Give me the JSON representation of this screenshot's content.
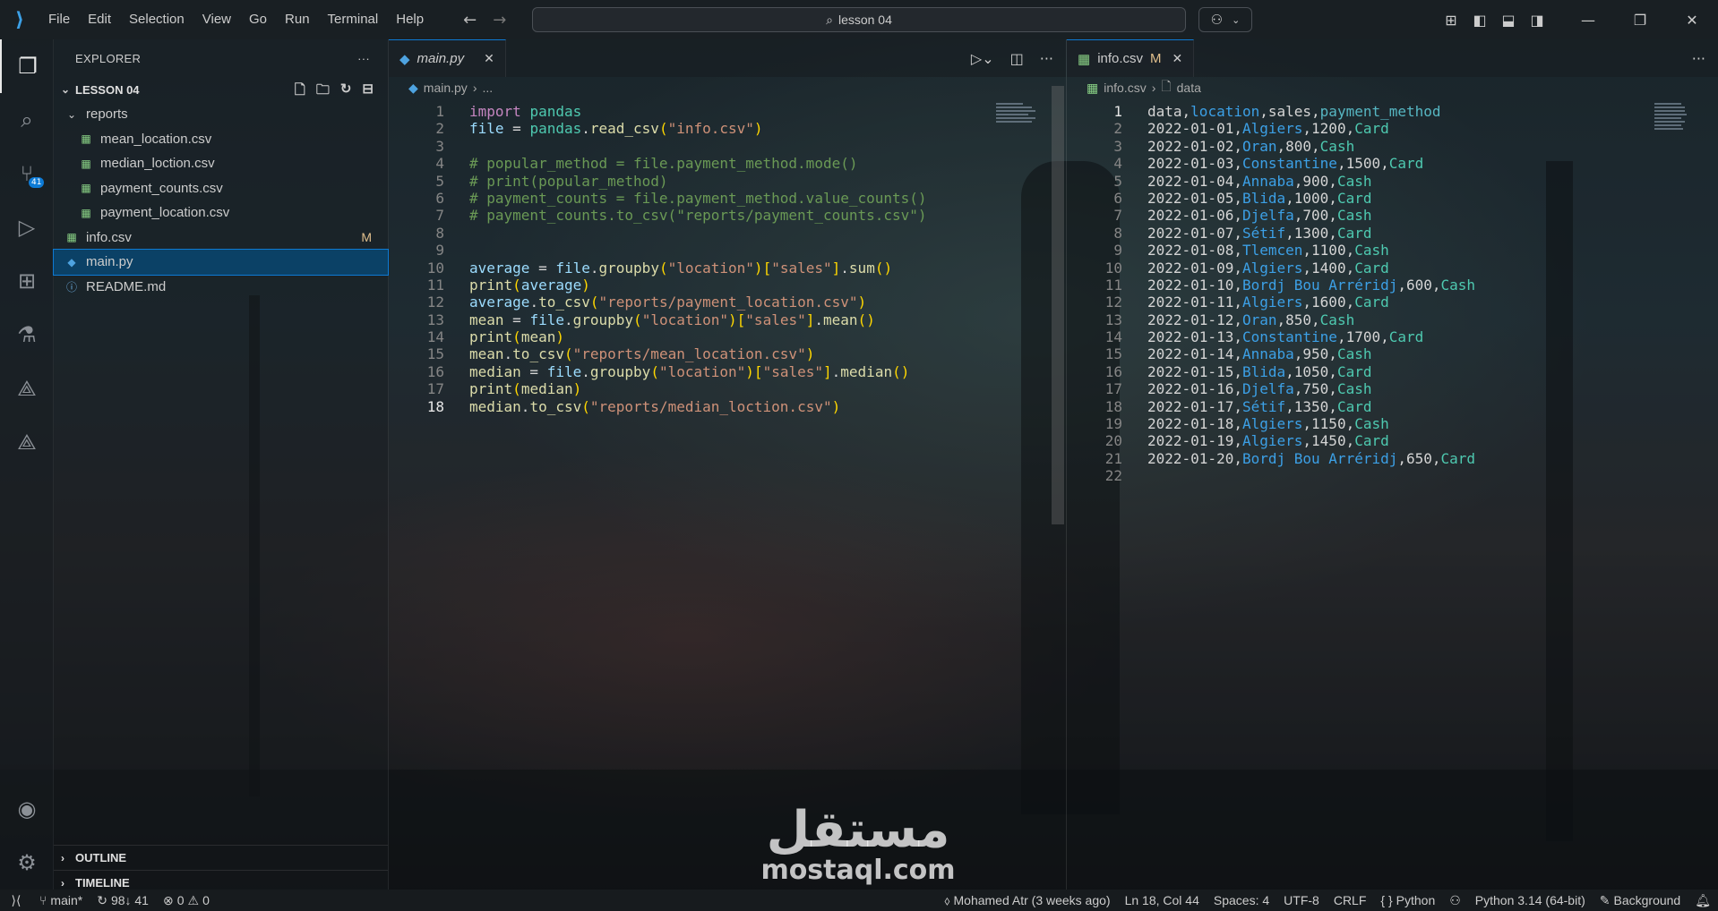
{
  "titlebar": {
    "menu": [
      "File",
      "Edit",
      "Selection",
      "View",
      "Go",
      "Run",
      "Terminal",
      "Help"
    ],
    "search_text": "lesson 04"
  },
  "activitybar": {
    "source_control_badge": "41"
  },
  "sidebar": {
    "title": "EXPLORER",
    "section": "LESSON 04",
    "tree": [
      {
        "label": "reports",
        "type": "folder",
        "depth": 1
      },
      {
        "label": "mean_location.csv",
        "type": "csv",
        "depth": 2
      },
      {
        "label": "median_loction.csv",
        "type": "csv",
        "depth": 2
      },
      {
        "label": "payment_counts.csv",
        "type": "csv",
        "depth": 2
      },
      {
        "label": "payment_location.csv",
        "type": "csv",
        "depth": 2
      },
      {
        "label": "info.csv",
        "type": "csv",
        "depth": 1,
        "badge": "M"
      },
      {
        "label": "main.py",
        "type": "py",
        "depth": 1,
        "selected": true
      },
      {
        "label": "README.md",
        "type": "info",
        "depth": 1
      }
    ],
    "outline": "OUTLINE",
    "timeline": "TIMELINE"
  },
  "editor_left": {
    "tab": "main.py",
    "breadcrumb": [
      "main.py",
      "..."
    ],
    "current_line": 18
  },
  "editor_right": {
    "tab": "info.csv",
    "tab_badge": "M",
    "breadcrumb": [
      "info.csv",
      "data"
    ],
    "current_line": 1
  },
  "python_lines": [
    "import pandas",
    "file = pandas.read_csv(\"info.csv\")",
    "",
    "# popular_method = file.payment_method.mode()",
    "# print(popular_method)",
    "# payment_counts = file.payment_method.value_counts()",
    "# payment_counts.to_csv(\"reports/payment_counts.csv\")",
    "",
    "",
    "average = file.groupby(\"location\")[\"sales\"].sum()",
    "print(average)",
    "average.to_csv(\"reports/payment_location.csv\")",
    "mean = file.groupby(\"location\")[\"sales\"].mean()",
    "print(mean)",
    "mean.to_csv(\"reports/mean_location.csv\")",
    "median = file.groupby(\"location\")[\"sales\"].median()",
    "print(median)",
    "median.to_csv(\"reports/median_loction.csv\")"
  ],
  "csv_header": [
    "data",
    "location",
    "sales",
    "payment_method"
  ],
  "csv_rows": [
    [
      "2022-01-01",
      "Algiers",
      "1200",
      "Card"
    ],
    [
      "2022-01-02",
      "Oran",
      "800",
      "Cash"
    ],
    [
      "2022-01-03",
      "Constantine",
      "1500",
      "Card"
    ],
    [
      "2022-01-04",
      "Annaba",
      "900",
      "Cash"
    ],
    [
      "2022-01-05",
      "Blida",
      "1000",
      "Card"
    ],
    [
      "2022-01-06",
      "Djelfa",
      "700",
      "Cash"
    ],
    [
      "2022-01-07",
      "Sétif",
      "1300",
      "Card"
    ],
    [
      "2022-01-08",
      "Tlemcen",
      "1100",
      "Cash"
    ],
    [
      "2022-01-09",
      "Algiers",
      "1400",
      "Card"
    ],
    [
      "2022-01-10",
      "Bordj Bou Arréridj",
      "600",
      "Cash"
    ],
    [
      "2022-01-11",
      "Algiers",
      "1600",
      "Card"
    ],
    [
      "2022-01-12",
      "Oran",
      "850",
      "Cash"
    ],
    [
      "2022-01-13",
      "Constantine",
      "1700",
      "Card"
    ],
    [
      "2022-01-14",
      "Annaba",
      "950",
      "Cash"
    ],
    [
      "2022-01-15",
      "Blida",
      "1050",
      "Card"
    ],
    [
      "2022-01-16",
      "Djelfa",
      "750",
      "Cash"
    ],
    [
      "2022-01-17",
      "Sétif",
      "1350",
      "Card"
    ],
    [
      "2022-01-18",
      "Algiers",
      "1150",
      "Cash"
    ],
    [
      "2022-01-19",
      "Algiers",
      "1450",
      "Card"
    ],
    [
      "2022-01-20",
      "Bordj Bou Arréridj",
      "650",
      "Card"
    ]
  ],
  "watermark": {
    "arabic": "مستقل",
    "latin": "mostaql.com"
  },
  "statusbar": {
    "branch": "main*",
    "sync": "98↓ 41",
    "errors": "0",
    "warnings": "0",
    "blame": "Mohamed Atr (3 weeks ago)",
    "position": "Ln 18, Col 44",
    "spaces": "Spaces: 4",
    "encoding": "UTF-8",
    "eol": "CRLF",
    "language": "Python",
    "interpreter": "Python 3.14 (64-bit)",
    "background": "Background"
  }
}
